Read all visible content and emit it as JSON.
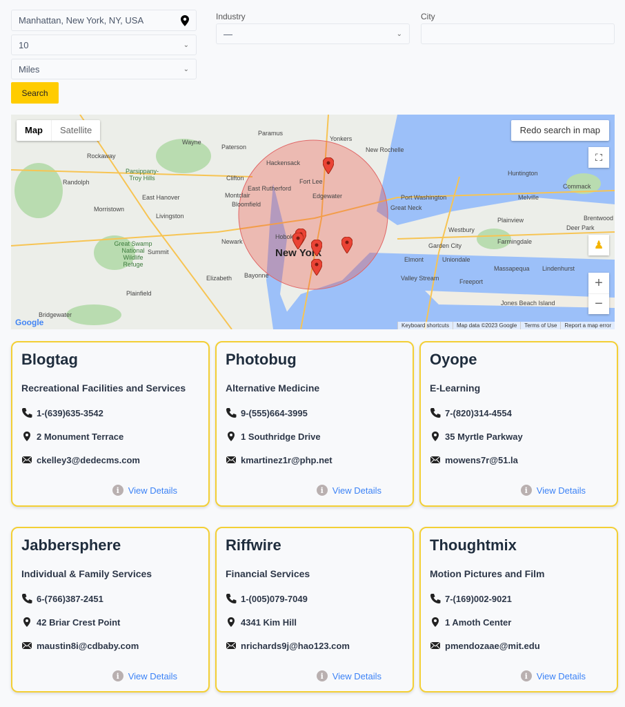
{
  "search": {
    "location": "Manhattan, New York, NY, USA",
    "radius": "10",
    "unit": "Miles",
    "button": "Search"
  },
  "filters": {
    "industry_label": "Industry",
    "industry_value": "—",
    "city_label": "City",
    "city_value": ""
  },
  "map": {
    "type_map": "Map",
    "type_satellite": "Satellite",
    "redo": "Redo search in map",
    "zoom_in": "+",
    "zoom_out": "−",
    "attribution": [
      "Keyboard shortcuts",
      "Map data ©2023 Google",
      "Terms of Use",
      "Report a map error"
    ],
    "labels": [
      "Yonkers",
      "Paramus",
      "Hackensack",
      "New Rochelle",
      "Fort Lee",
      "Paterson",
      "Wayne",
      "Clifton",
      "East Rutherford",
      "Edgewater",
      "Montclair",
      "Bloomfield",
      "Newark",
      "Hoboken",
      "New York",
      "Elizabeth",
      "Bayonne",
      "Great Neck",
      "Port Washington",
      "Huntington",
      "Commack",
      "Plainview",
      "Melville",
      "Westbury",
      "Garden City",
      "Farmingdale",
      "Elmont",
      "Valley Stream",
      "Freeport",
      "Massapequa",
      "Lindenhurst",
      "Livingston",
      "East Hanover",
      "Morristown",
      "Summit",
      "Plainfield",
      "Bridgewater",
      "Rockaway",
      "Parsippany-Troy Hills",
      "Randolph",
      "Great Swamp National Wildlife Refuge",
      "Jones Beach Island",
      "Deer Park",
      "Brentwood",
      "Uniondale"
    ],
    "accent": "#ea4335"
  },
  "cards": [
    {
      "name": "Blogtag",
      "industry": "Recreational Facilities and Services",
      "phone": "1-(639)635-3542",
      "address": "2 Monument Terrace",
      "email": "ckelley3@dedecms.com",
      "link": "View Details"
    },
    {
      "name": "Photobug",
      "industry": "Alternative Medicine",
      "phone": "9-(555)664-3995",
      "address": "1 Southridge Drive",
      "email": "kmartinez1r@php.net",
      "link": "View Details"
    },
    {
      "name": "Oyope",
      "industry": "E-Learning",
      "phone": "7-(820)314-4554",
      "address": "35 Myrtle Parkway",
      "email": "mowens7r@51.la",
      "link": "View Details"
    },
    {
      "name": "Jabbersphere",
      "industry": "Individual & Family Services",
      "phone": "6-(766)387-2451",
      "address": "42 Briar Crest Point",
      "email": "maustin8i@cdbaby.com",
      "link": "View Details"
    },
    {
      "name": "Riffwire",
      "industry": "Financial Services",
      "phone": "1-(005)079-7049",
      "address": "4341 Kim Hill",
      "email": "nrichards9j@hao123.com",
      "link": "View Details"
    },
    {
      "name": "Thoughtmix",
      "industry": "Motion Pictures and Film",
      "phone": "7-(169)002-9021",
      "address": "1 Amoth Center",
      "email": "pmendozaae@mit.edu",
      "link": "View Details"
    }
  ],
  "colors": {
    "brand": "#ffcc00",
    "card_border": "#f3cf34",
    "link": "#3b82f6"
  }
}
